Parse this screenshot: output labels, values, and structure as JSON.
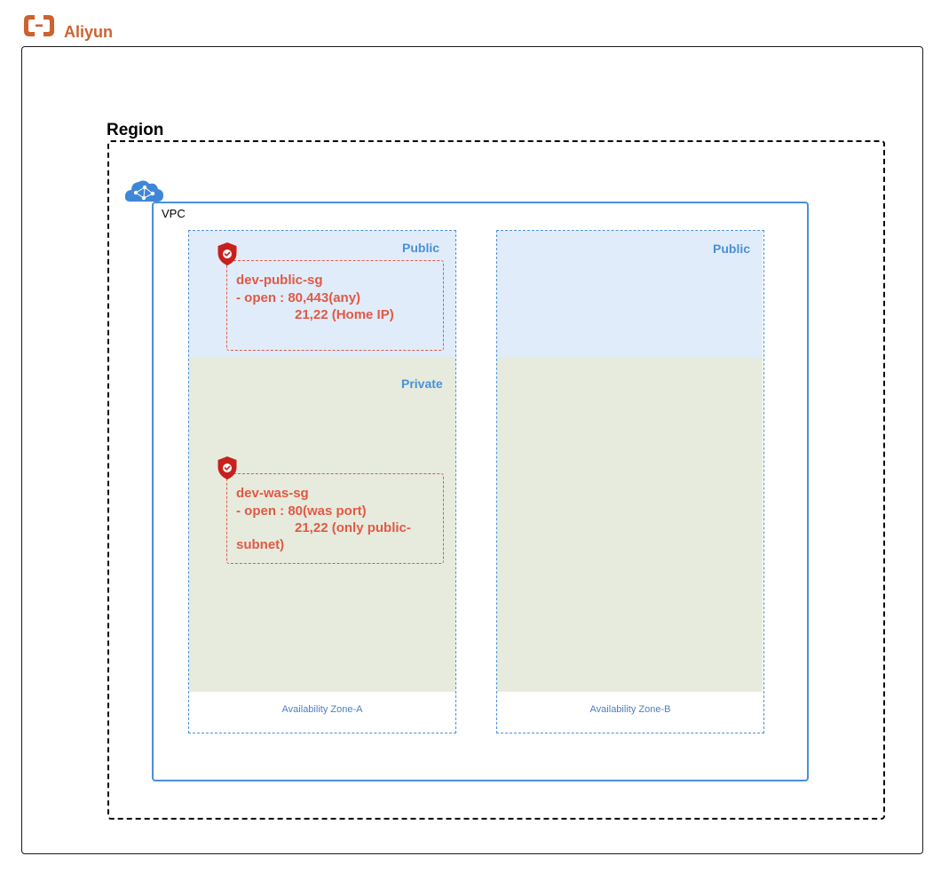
{
  "brand": {
    "name": "Aliyun",
    "icon": "aliyun-logo-icon",
    "color": "#cc6230"
  },
  "region": {
    "title": "Region"
  },
  "vpc": {
    "label": "VPC",
    "icon": "vpc-cloud-icon",
    "color": "#4a90d9"
  },
  "zones": [
    {
      "label": "Availability Zone-A",
      "public_label": "Public",
      "private_label": "Private"
    },
    {
      "label": "Availability Zone-B",
      "public_label": "Public"
    }
  ],
  "security_groups": [
    {
      "name": "dev-public-sg",
      "line1": "- open : 80,443(any)",
      "line2": "21,22 (Home IP)",
      "icon": "shield-check-icon"
    },
    {
      "name": "dev-was-sg",
      "line1": "- open : 80(was port)",
      "line2": "21,22 (only public-",
      "line3": "subnet)",
      "icon": "shield-check-icon"
    }
  ],
  "colors": {
    "public_subnet": "#e1ecfa",
    "private_subnet": "#e6ebdd",
    "security_group": "#e05a45",
    "shield": "#c7211d"
  }
}
